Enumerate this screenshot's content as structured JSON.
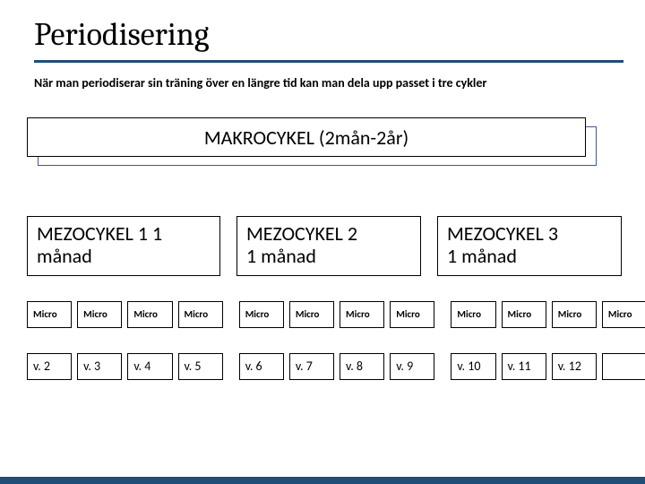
{
  "title": "Periodisering",
  "subtitle": "När man periodiserar sin träning över en längre tid kan man dela upp passet i tre cykler",
  "makro": {
    "label": "MAKROCYKEL (2mån-2år)"
  },
  "mezo": [
    {
      "label_line1": "MEZOCYKEL 1 1",
      "label_line2": "månad"
    },
    {
      "label_line1": "MEZOCYKEL 2",
      "label_line2": "1 månad"
    },
    {
      "label_line1": "MEZOCYKEL 3",
      "label_line2": "1 månad"
    }
  ],
  "micro": {
    "header_label": "Micro",
    "weeks": [
      "v. 2",
      "v. 3",
      "v. 4",
      "v. 5",
      "v. 6",
      "v. 7",
      "v. 8",
      "v. 9",
      "v. 10",
      "v. 11",
      "v. 12",
      ""
    ]
  },
  "colors": {
    "accent": "#1f4e79"
  }
}
